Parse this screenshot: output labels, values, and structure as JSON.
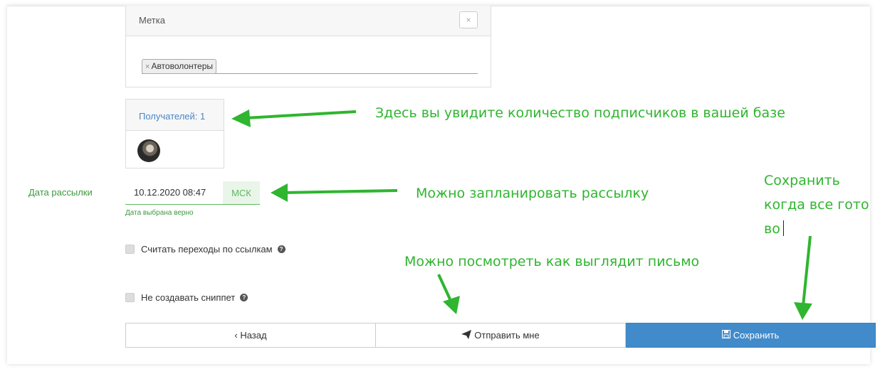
{
  "tag_panel": {
    "title": "Метка",
    "close_icon": "×",
    "tags": [
      {
        "remove": "×",
        "label": "Автоволонтеры"
      }
    ]
  },
  "recipients": {
    "label": "Получателей: 1"
  },
  "schedule": {
    "label": "Дата рассылки",
    "value": "10.12.2020 08:47",
    "timezone": "МСК",
    "hint": "Дата выбрана верно"
  },
  "options": {
    "track_links": "Считать переходы по ссылкам",
    "no_snippet": "Не создавать сниппет",
    "help_icon": "?"
  },
  "buttons": {
    "back": "‹ Назад",
    "send_me": "Отправить мне",
    "save": "Сохранить"
  },
  "annotations": {
    "recipients_note": "Здесь вы увидите количество подписчиков в вашей базе",
    "schedule_note": "Можно запланировать рассылку",
    "preview_note": "Можно посмотреть как выглядит письмо",
    "save_note_line1": "Сохранить",
    "save_note_line2": "когда все гото",
    "save_note_line3": "во"
  },
  "colors": {
    "annotation": "#2fb52f",
    "primary_button": "#428bca",
    "success": "#5cb85c"
  }
}
